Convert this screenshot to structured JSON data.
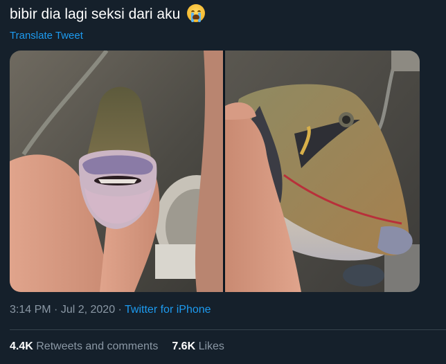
{
  "tweet": {
    "text": "bibir dia lagi seksi dari aku",
    "emoji": "loudly-crying-face",
    "translate_label": "Translate Tweet"
  },
  "meta": {
    "time": "3:14 PM",
    "separator1": " · ",
    "date": "Jul 2, 2020",
    "separator2": " · ",
    "source": "Twitter for iPhone"
  },
  "stats": {
    "retweets_count": "4.4K",
    "retweets_label": "Retweets and comments",
    "likes_count": "7.6K",
    "likes_label": "Likes"
  },
  "colors": {
    "background": "#15202b",
    "link": "#1d9bf0",
    "secondary_text": "#8b98a5",
    "divider": "#38444d"
  }
}
